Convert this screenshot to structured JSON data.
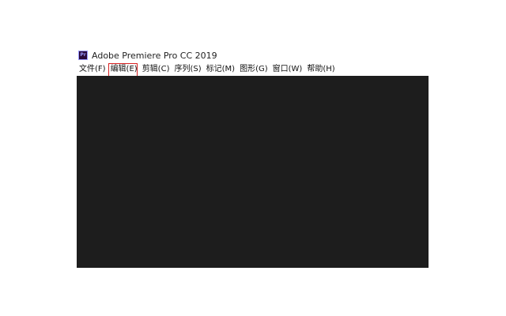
{
  "window": {
    "title": "Adobe Premiere Pro CC 2019",
    "icon_name": "premiere-pro-app-icon",
    "icon_text": "Pr"
  },
  "menubar": {
    "items": [
      {
        "label": "文件(F)"
      },
      {
        "label": "编辑(E)",
        "highlighted": true
      },
      {
        "label": "剪辑(C)"
      },
      {
        "label": "序列(S)"
      },
      {
        "label": "标记(M)"
      },
      {
        "label": "图形(G)"
      },
      {
        "label": "窗口(W)"
      },
      {
        "label": "帮助(H)"
      }
    ]
  },
  "colors": {
    "workspace_bg": "#1d1d1d",
    "highlight_box": "#d62020",
    "icon_bg": "#2a0a3a",
    "icon_accent": "#9999ff"
  }
}
